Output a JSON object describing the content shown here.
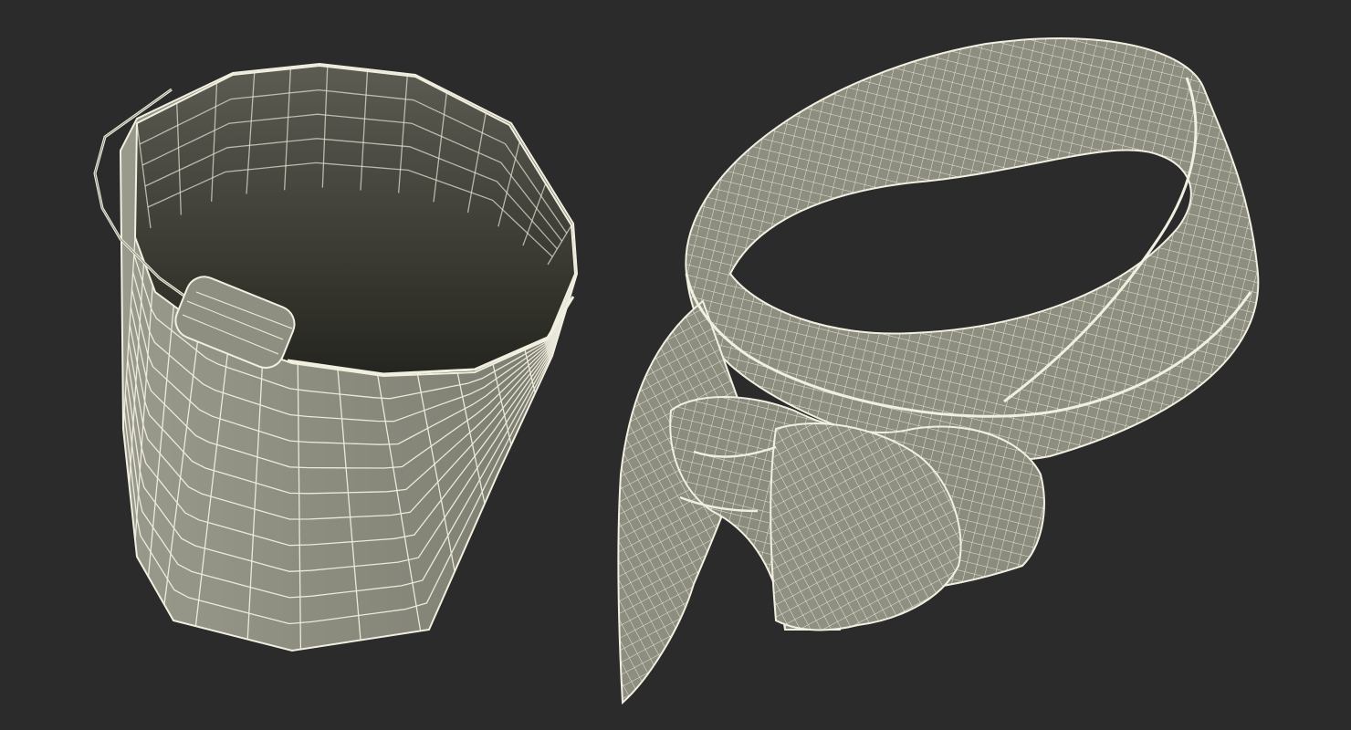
{
  "scene": {
    "background_color": "#2b2b2b",
    "objects": [
      {
        "id": "bucket",
        "label": "wireframe-bucket",
        "shading_color": "#8c8c7f",
        "inner_shadow_color": "#3a3a34",
        "wire_color": "#f1efe0",
        "vertical_segments": 16,
        "horizontal_rings": 11,
        "has_handle": true
      },
      {
        "id": "scarf",
        "label": "wireframe-neckerchief",
        "shading_color": "#8d8d80",
        "wire_color": "#f1efe0",
        "has_knot": true
      }
    ]
  }
}
